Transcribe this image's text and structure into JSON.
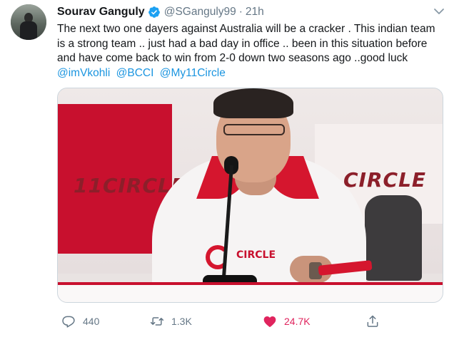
{
  "tweet": {
    "author": {
      "display_name": "Sourav Ganguly",
      "handle": "@SGanguly99",
      "verified": true,
      "time": "21h"
    },
    "text_lines": [
      "The next two one dayers against Australia will be a cracker . This indian team",
      "is a strong team .. just had a bad day in office .. been in this situation before",
      "and have come back to win from 2-0 down two seasons ago ..good luck"
    ],
    "mentions": [
      "@imVkohli",
      "@BCCI",
      "@My11Circle"
    ],
    "media": {
      "logo_left": "11CIRCLE",
      "logo_right": "CIRCLE",
      "shirt_text": "CIRCLE"
    },
    "actions": {
      "reply_count": "440",
      "retweet_count": "1.3K",
      "like_count": "24.7K",
      "liked": true
    }
  },
  "icons": {
    "verified": "verified-badge-icon",
    "caret": "chevron-down-icon",
    "reply": "reply-icon",
    "retweet": "retweet-icon",
    "like": "heart-icon",
    "share": "share-icon"
  },
  "colors": {
    "link": "#1b95e0",
    "secondary_text": "#657786",
    "like": "#e0245e",
    "verified": "#1da1f2",
    "brand_red": "#c8102e"
  }
}
